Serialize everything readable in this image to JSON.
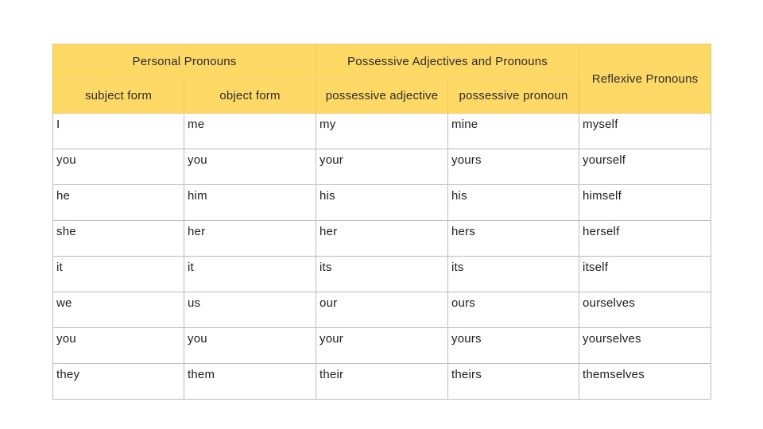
{
  "table": {
    "group_headers": {
      "personal": "Personal Pronouns",
      "possessive": "Possessive Adjectives and Pronouns",
      "reflexive": "Reflexive Pronouns"
    },
    "sub_headers": [
      "subject form",
      "object form",
      "possessive adjective",
      "possessive pronoun"
    ],
    "rows": [
      [
        "I",
        "me",
        "my",
        "mine",
        "myself"
      ],
      [
        "you",
        "you",
        "your",
        "yours",
        "yourself"
      ],
      [
        "he",
        "him",
        "his",
        "his",
        "himself"
      ],
      [
        "she",
        "her",
        "her",
        "hers",
        "herself"
      ],
      [
        "it",
        "it",
        "its",
        "its",
        "itself"
      ],
      [
        "we",
        "us",
        "our",
        "ours",
        "ourselves"
      ],
      [
        "you",
        "you",
        "your",
        "yours",
        "yourselves"
      ],
      [
        "they",
        "them",
        "their",
        "theirs",
        "themselves"
      ]
    ]
  },
  "colors": {
    "header_bg": "#ffd966",
    "border": "#bdbdbd"
  }
}
